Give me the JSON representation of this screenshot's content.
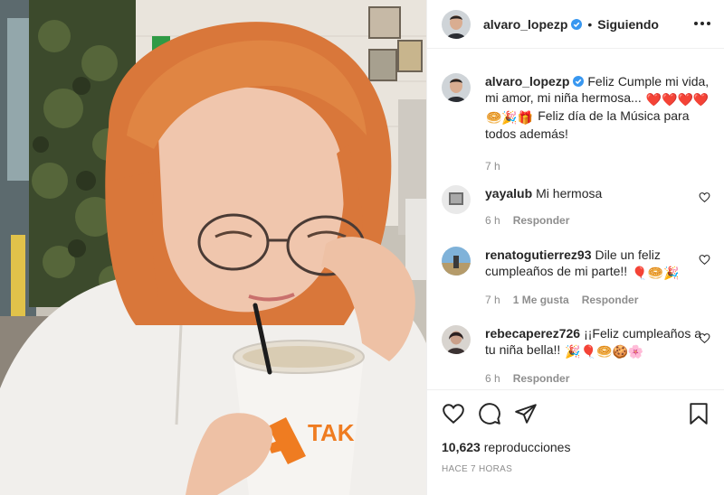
{
  "post": {
    "author": "alvaro_lopezp",
    "follow_status": "Siguiendo",
    "separator": "•"
  },
  "media": {
    "cup_brand": "TAK"
  },
  "caption": {
    "user": "alvaro_lopezp",
    "text_1": "Feliz Cumple mi vida, mi amor, mi niña hermosa...",
    "emojis_1": "❤️❤️❤️❤️",
    "emojis_2": "🥯🎉🎁",
    "text_2": "Feliz día de la Música para todos además!",
    "time": "7 h"
  },
  "comments": [
    {
      "user": "yayalub",
      "text": "Mi hermosa",
      "emojis": "",
      "time": "6 h",
      "likes": "",
      "reply": "Responder"
    },
    {
      "user": "renatogutierrez93",
      "text": "Dile un feliz cumpleaños de mi parte!!",
      "emojis": "🎈🥯🎉",
      "time": "7 h",
      "likes": "1 Me gusta",
      "reply": "Responder"
    },
    {
      "user": "rebecaperez726",
      "text": "¡¡Feliz cumpleaños a tu niña bella!!",
      "emojis": "🎉🎈🥯🍪🌸",
      "time": "6 h",
      "likes": "",
      "reply": "Responder"
    }
  ],
  "footer": {
    "views_count": "10,623",
    "views_label": "reproducciones",
    "time_ago": "HACE 7 HORAS"
  },
  "colors": {
    "verified": "#3897f0",
    "text": "#262626",
    "muted": "#8e8e8e",
    "border": "#efefef"
  },
  "icons": {
    "like": "heart-outline-icon",
    "comment": "speech-bubble-icon",
    "share": "paper-plane-icon",
    "save": "bookmark-icon",
    "more": "more-horizontal-icon"
  }
}
